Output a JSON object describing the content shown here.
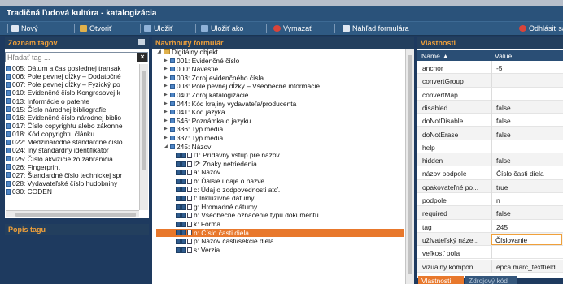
{
  "window": {
    "title": "Tradičná ľudová kultúra - katalogizácia"
  },
  "toolbar": {
    "new": "Nový",
    "open": "Otvoriť",
    "save": "Uložiť",
    "save_as": "Uložiť ako",
    "delete": "Vymazať",
    "preview": "Náhľad formulára",
    "logout": "Odhlásiť sa"
  },
  "tags_panel": {
    "title": "Zoznam tagov",
    "search_placeholder": "Hľadať tag ...",
    "items": [
      "005: Dátum a čas poslednej transak",
      "006: Pole pevnej dĺžky – Dodatočné",
      "007: Pole pevnej dĺžky – Fyzický po",
      "010: Evidenčné číslo Kongresovej k",
      "013: Informácie o patente",
      "015: Číslo národnej bibliografie",
      "016: Evidenčné číslo národnej biblio",
      "017: Číslo copyrightu alebo zákonne",
      "018: Kód copyrightu článku",
      "022: Medzinárodné štandardné číslo",
      "024: Iný štandardný identifikátor",
      "025: Číslo akvizície zo zahraničia",
      "026: Fingerprint",
      "027: Štandardné číslo technickej spr",
      "028: Vydavateľské číslo hudobniny",
      "030: CODEN"
    ]
  },
  "desc_panel": {
    "title": "Popis tagu"
  },
  "form_panel": {
    "title": "Navrhnutý formulár",
    "root": "Digitálny objekt",
    "nodes": [
      "001: Evidenčné číslo",
      "000: Návestie",
      "003: Zdroj evidenčného čísla",
      "008: Pole pevnej dĺžky – Všeobecné informácie",
      "040: Zdroj katalogizácie",
      "044: Kód krajiny vydavateľa/producenta",
      "041: Kód jazyka",
      "546: Poznámka o jazyku",
      "336: Typ média",
      "337: Typ média"
    ],
    "expanded_node": "245: Názov",
    "subfields": [
      "l1: Prídavný vstup pre názov",
      "l2: Znaky netriedenia",
      "a: Názov",
      "b: Ďalšie údaje o názve",
      "c: Údaj o zodpovednosti atď.",
      "f: Inkluzívne dátumy",
      "g: Hromadné dátumy",
      "h: Všeobecné označenie typu dokumentu",
      "k: Forma",
      "n: Číslo časti diela",
      "p: Názov časti/sekcie diela",
      "s: Verzia"
    ],
    "selected_subfield": "n: Číslo časti diela"
  },
  "props_panel": {
    "title": "Vlastnosti",
    "col_name": "Name",
    "col_value": "Value",
    "rows": [
      {
        "name": "anchor",
        "value": "-5"
      },
      {
        "name": "convertGroup",
        "value": ""
      },
      {
        "name": "convertMap",
        "value": ""
      },
      {
        "name": "disabled",
        "value": "false"
      },
      {
        "name": "doNotDisable",
        "value": "false"
      },
      {
        "name": "doNotErase",
        "value": "false"
      },
      {
        "name": "help",
        "value": ""
      },
      {
        "name": "hidden",
        "value": "false"
      },
      {
        "name": "názov podpole",
        "value": "Číslo časti diela"
      },
      {
        "name": "opakovateľné po...",
        "value": "true"
      },
      {
        "name": "podpole",
        "value": "n"
      },
      {
        "name": "required",
        "value": "false"
      },
      {
        "name": "tag",
        "value": "245"
      },
      {
        "name": "užívateľský náze...",
        "value": "Číslovanie"
      },
      {
        "name": "veľkosť poľa",
        "value": ""
      },
      {
        "name": "vizuálny kompon...",
        "value": "epca.marc_textfield"
      }
    ]
  },
  "bottom_tabs": {
    "properties": "Vlastnosti",
    "source": "Zdrojový kód"
  },
  "colors": {
    "accent": "#f0a03a",
    "selection": "#e8782c",
    "panel_bg": "#1e3a5f",
    "header": "#2a527a"
  }
}
